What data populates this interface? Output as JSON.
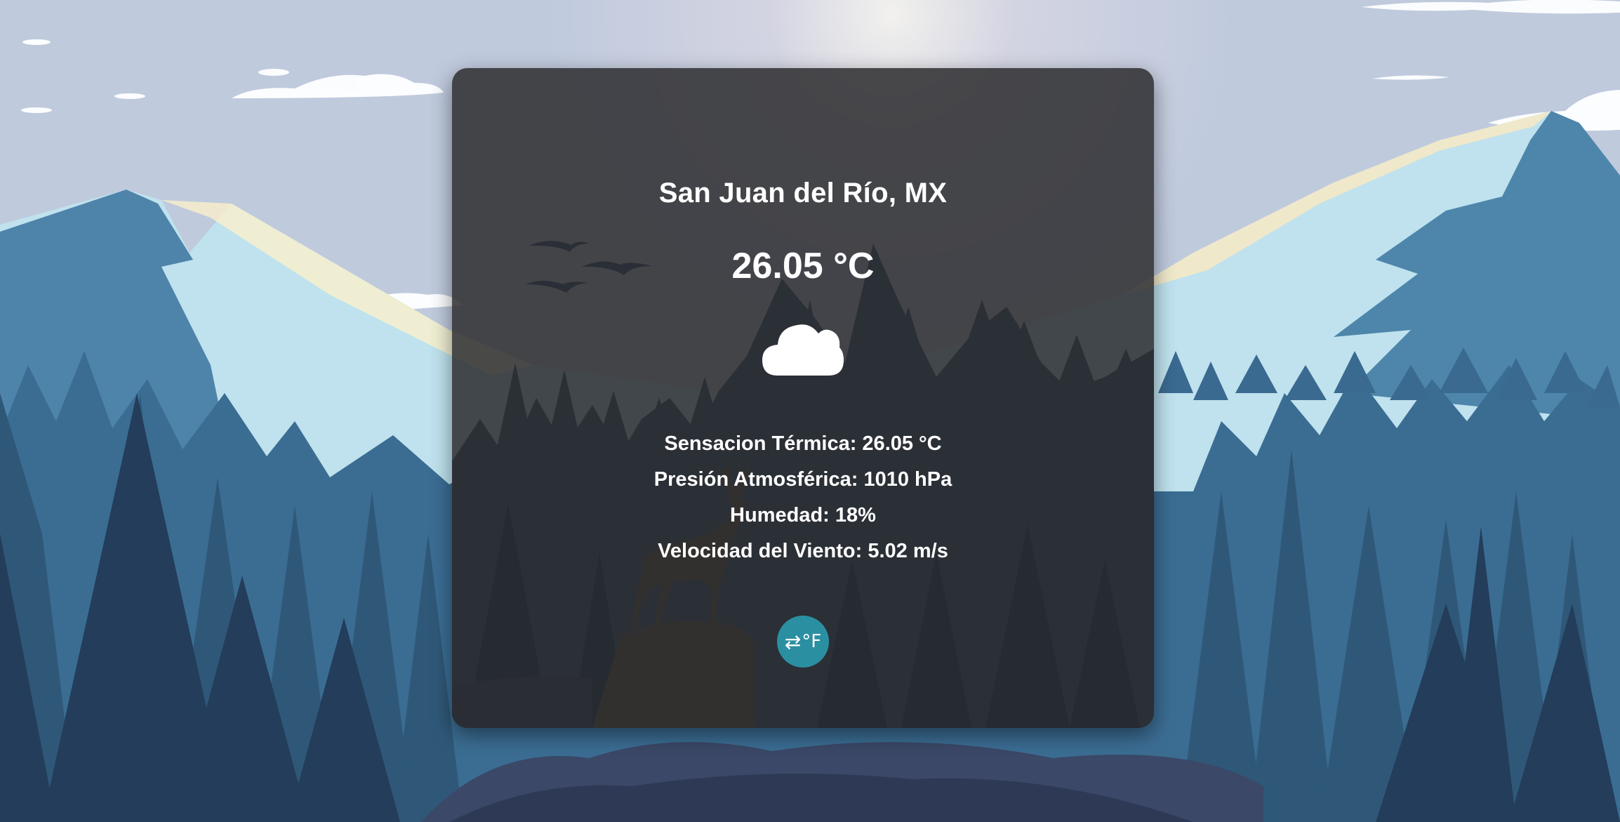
{
  "weather": {
    "city": "San Juan del Río, MX",
    "temperature": "26.05 °C",
    "condition_icon": "cloud-icon",
    "details": [
      {
        "label": "Sensacion Térmica: 26.05 °C"
      },
      {
        "label": "Presión Atmosférica: 1010 hPa"
      },
      {
        "label": "Humedad: 18%"
      },
      {
        "label": "Velocidad del Viento: 5.02 m/s"
      }
    ]
  },
  "unit_toggle": {
    "icon": "swap-arrows-icon",
    "label": "°F",
    "color": "#2b8fa2"
  },
  "theme": {
    "sky": "#c7d3e2",
    "mountain_dark": "#4a7ea4",
    "mountain_light": "#bfe3ee",
    "forest_far": "#37658a",
    "forest_near": "#24405f",
    "card_bg": "#2d2d30"
  }
}
